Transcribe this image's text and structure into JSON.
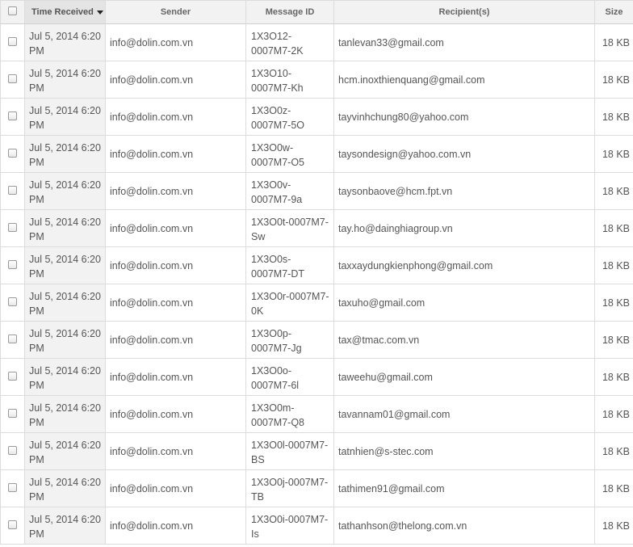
{
  "table": {
    "headers": {
      "time": "Time Received",
      "sender": "Sender",
      "message_id": "Message ID",
      "recipients": "Recipient(s)",
      "size": "Size"
    },
    "rows": [
      {
        "time": "Jul 5, 2014 6:20 PM",
        "sender": "info@dolin.com.vn",
        "message_id": "1X3O12-0007M7-2K",
        "recipient": "tanlevan33@gmail.com",
        "size": "18 KB"
      },
      {
        "time": "Jul 5, 2014 6:20 PM",
        "sender": "info@dolin.com.vn",
        "message_id": "1X3O10-0007M7-Kh",
        "recipient": "hcm.inoxthienquang@gmail.com",
        "size": "18 KB"
      },
      {
        "time": "Jul 5, 2014 6:20 PM",
        "sender": "info@dolin.com.vn",
        "message_id": "1X3O0z-0007M7-5O",
        "recipient": "tayvinhchung80@yahoo.com",
        "size": "18 KB"
      },
      {
        "time": "Jul 5, 2014 6:20 PM",
        "sender": "info@dolin.com.vn",
        "message_id": "1X3O0w-0007M7-O5",
        "recipient": "taysondesign@yahoo.com.vn",
        "size": "18 KB"
      },
      {
        "time": "Jul 5, 2014 6:20 PM",
        "sender": "info@dolin.com.vn",
        "message_id": "1X3O0v-0007M7-9a",
        "recipient": "taysonbaove@hcm.fpt.vn",
        "size": "18 KB"
      },
      {
        "time": "Jul 5, 2014 6:20 PM",
        "sender": "info@dolin.com.vn",
        "message_id": "1X3O0t-0007M7-Sw",
        "recipient": "tay.ho@dainghiagroup.vn",
        "size": "18 KB"
      },
      {
        "time": "Jul 5, 2014 6:20 PM",
        "sender": "info@dolin.com.vn",
        "message_id": "1X3O0s-0007M7-DT",
        "recipient": "taxxaydungkienphong@gmail.com",
        "size": "18 KB"
      },
      {
        "time": "Jul 5, 2014 6:20 PM",
        "sender": "info@dolin.com.vn",
        "message_id": "1X3O0r-0007M7-0K",
        "recipient": "taxuho@gmail.com",
        "size": "18 KB"
      },
      {
        "time": "Jul 5, 2014 6:20 PM",
        "sender": "info@dolin.com.vn",
        "message_id": "1X3O0p-0007M7-Jg",
        "recipient": "tax@tmac.com.vn",
        "size": "18 KB"
      },
      {
        "time": "Jul 5, 2014 6:20 PM",
        "sender": "info@dolin.com.vn",
        "message_id": "1X3O0o-0007M7-6l",
        "recipient": "taweehu@gmail.com",
        "size": "18 KB"
      },
      {
        "time": "Jul 5, 2014 6:20 PM",
        "sender": "info@dolin.com.vn",
        "message_id": "1X3O0m-0007M7-Q8",
        "recipient": "tavannam01@gmail.com",
        "size": "18 KB"
      },
      {
        "time": "Jul 5, 2014 6:20 PM",
        "sender": "info@dolin.com.vn",
        "message_id": "1X3O0l-0007M7-BS",
        "recipient": "tatnhien@s-stec.com",
        "size": "18 KB"
      },
      {
        "time": "Jul 5, 2014 6:20 PM",
        "sender": "info@dolin.com.vn",
        "message_id": "1X3O0j-0007M7-TB",
        "recipient": "tathimen91@gmail.com",
        "size": "18 KB"
      },
      {
        "time": "Jul 5, 2014 6:20 PM",
        "sender": "info@dolin.com.vn",
        "message_id": "1X3O0i-0007M7-Is",
        "recipient": "tathanhson@thelong.com.vn",
        "size": "18 KB"
      }
    ]
  }
}
